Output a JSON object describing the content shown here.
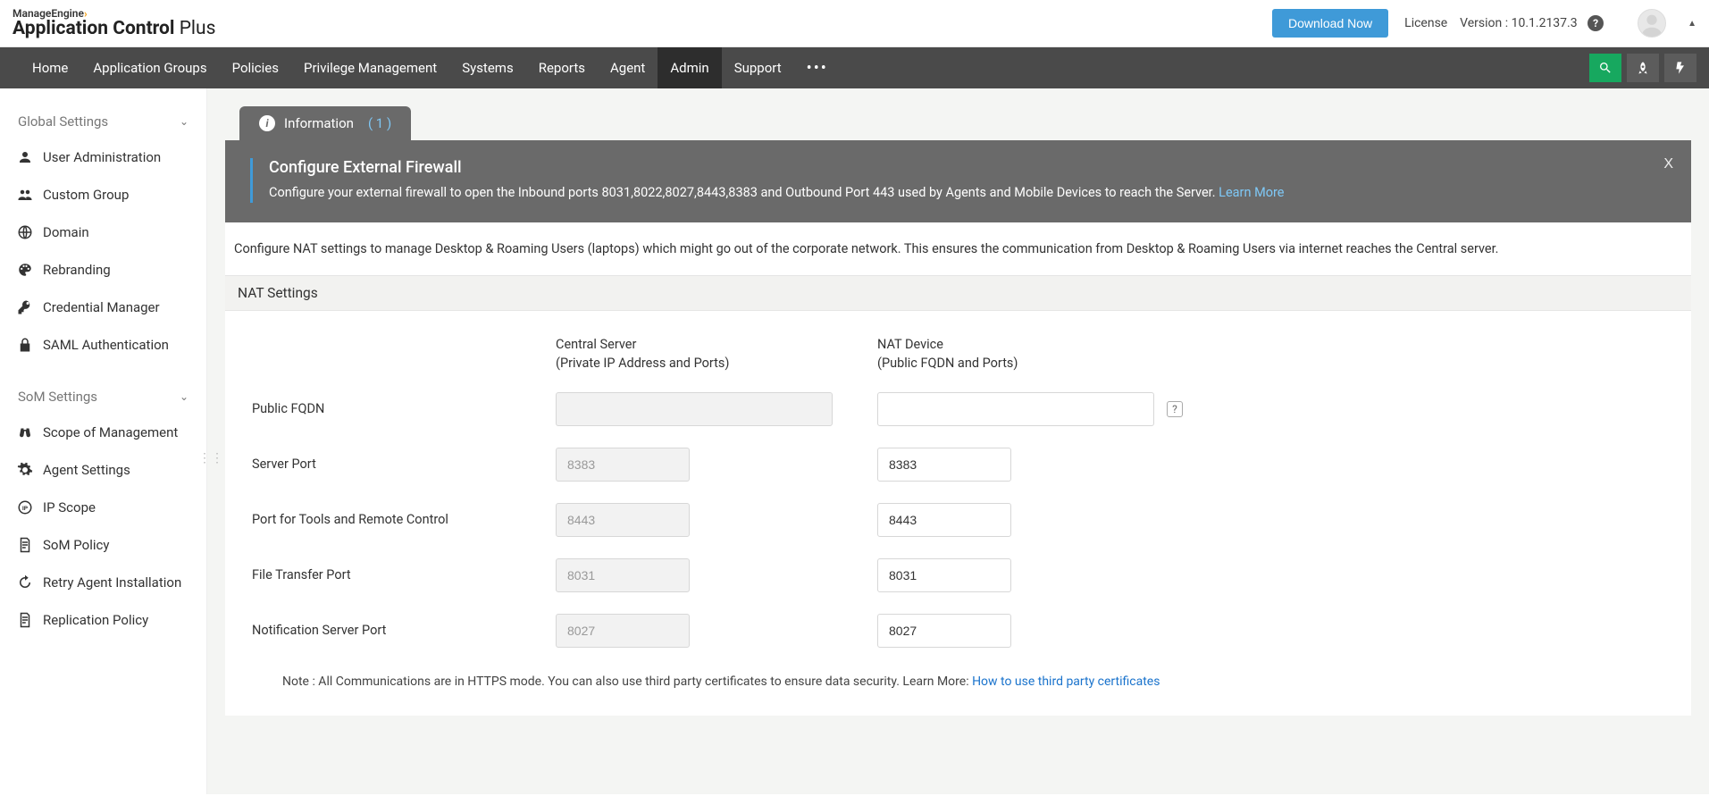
{
  "header": {
    "brand_top": "ManageEngine",
    "brand_main_strong": "Application Control",
    "brand_main_suffix": "Plus",
    "download_label": "Download Now",
    "license_label": "License",
    "version_label": "Version : 10.1.2137.3"
  },
  "nav": {
    "items": [
      "Home",
      "Application Groups",
      "Policies",
      "Privilege Management",
      "Systems",
      "Reports",
      "Agent",
      "Admin",
      "Support"
    ],
    "active_index": 7
  },
  "sidebar": {
    "sections": [
      {
        "title": "Global Settings",
        "items": [
          {
            "label": "User Administration",
            "icon": "user-icon"
          },
          {
            "label": "Custom Group",
            "icon": "group-icon"
          },
          {
            "label": "Domain",
            "icon": "globe-icon"
          },
          {
            "label": "Rebranding",
            "icon": "palette-icon"
          },
          {
            "label": "Credential Manager",
            "icon": "key-icon"
          },
          {
            "label": "SAML Authentication",
            "icon": "lock-icon"
          }
        ]
      },
      {
        "title": "SoM Settings",
        "items": [
          {
            "label": "Scope of Management",
            "icon": "binoculars-icon"
          },
          {
            "label": "Agent Settings",
            "icon": "gear-icon"
          },
          {
            "label": "IP Scope",
            "icon": "ip-icon"
          },
          {
            "label": "SoM Policy",
            "icon": "document-icon"
          },
          {
            "label": "Retry Agent Installation",
            "icon": "retry-icon"
          },
          {
            "label": "Replication Policy",
            "icon": "replication-icon"
          }
        ]
      }
    ]
  },
  "tab": {
    "label": "Information",
    "count": "( 1 )"
  },
  "banner": {
    "title": "Configure External Firewall",
    "body": "Configure your external firewall to open the Inbound ports 8031,8022,8027,8443,8383 and Outbound Port 443 used by Agents and Mobile Devices to reach the Server.",
    "learn_more": "Learn More"
  },
  "intro": "Configure NAT settings to manage Desktop & Roaming Users (laptops) which might go out of the corporate network. This ensures the communication from Desktop & Roaming Users via internet reaches the Central server.",
  "section_title": "NAT Settings",
  "cols": {
    "central_l1": "Central Server",
    "central_l2": "(Private IP Address and Ports)",
    "nat_l1": "NAT Device",
    "nat_l2": "(Public FQDN and Ports)"
  },
  "fields": {
    "public_fqdn": {
      "label": "Public FQDN",
      "central": "",
      "nat": ""
    },
    "server_port": {
      "label": "Server Port",
      "central": "8383",
      "nat": "8383"
    },
    "tools_port": {
      "label": "Port for Tools and Remote Control",
      "central": "8443",
      "nat": "8443"
    },
    "file_port": {
      "label": "File Transfer Port",
      "central": "8031",
      "nat": "8031"
    },
    "notify_port": {
      "label": "Notification Server Port",
      "central": "8027",
      "nat": "8027"
    }
  },
  "note": {
    "prefix": "Note : All Communications are in HTTPS mode. You can also use third party certificates to ensure data security. Learn More: ",
    "link": "How to use third party certificates"
  }
}
